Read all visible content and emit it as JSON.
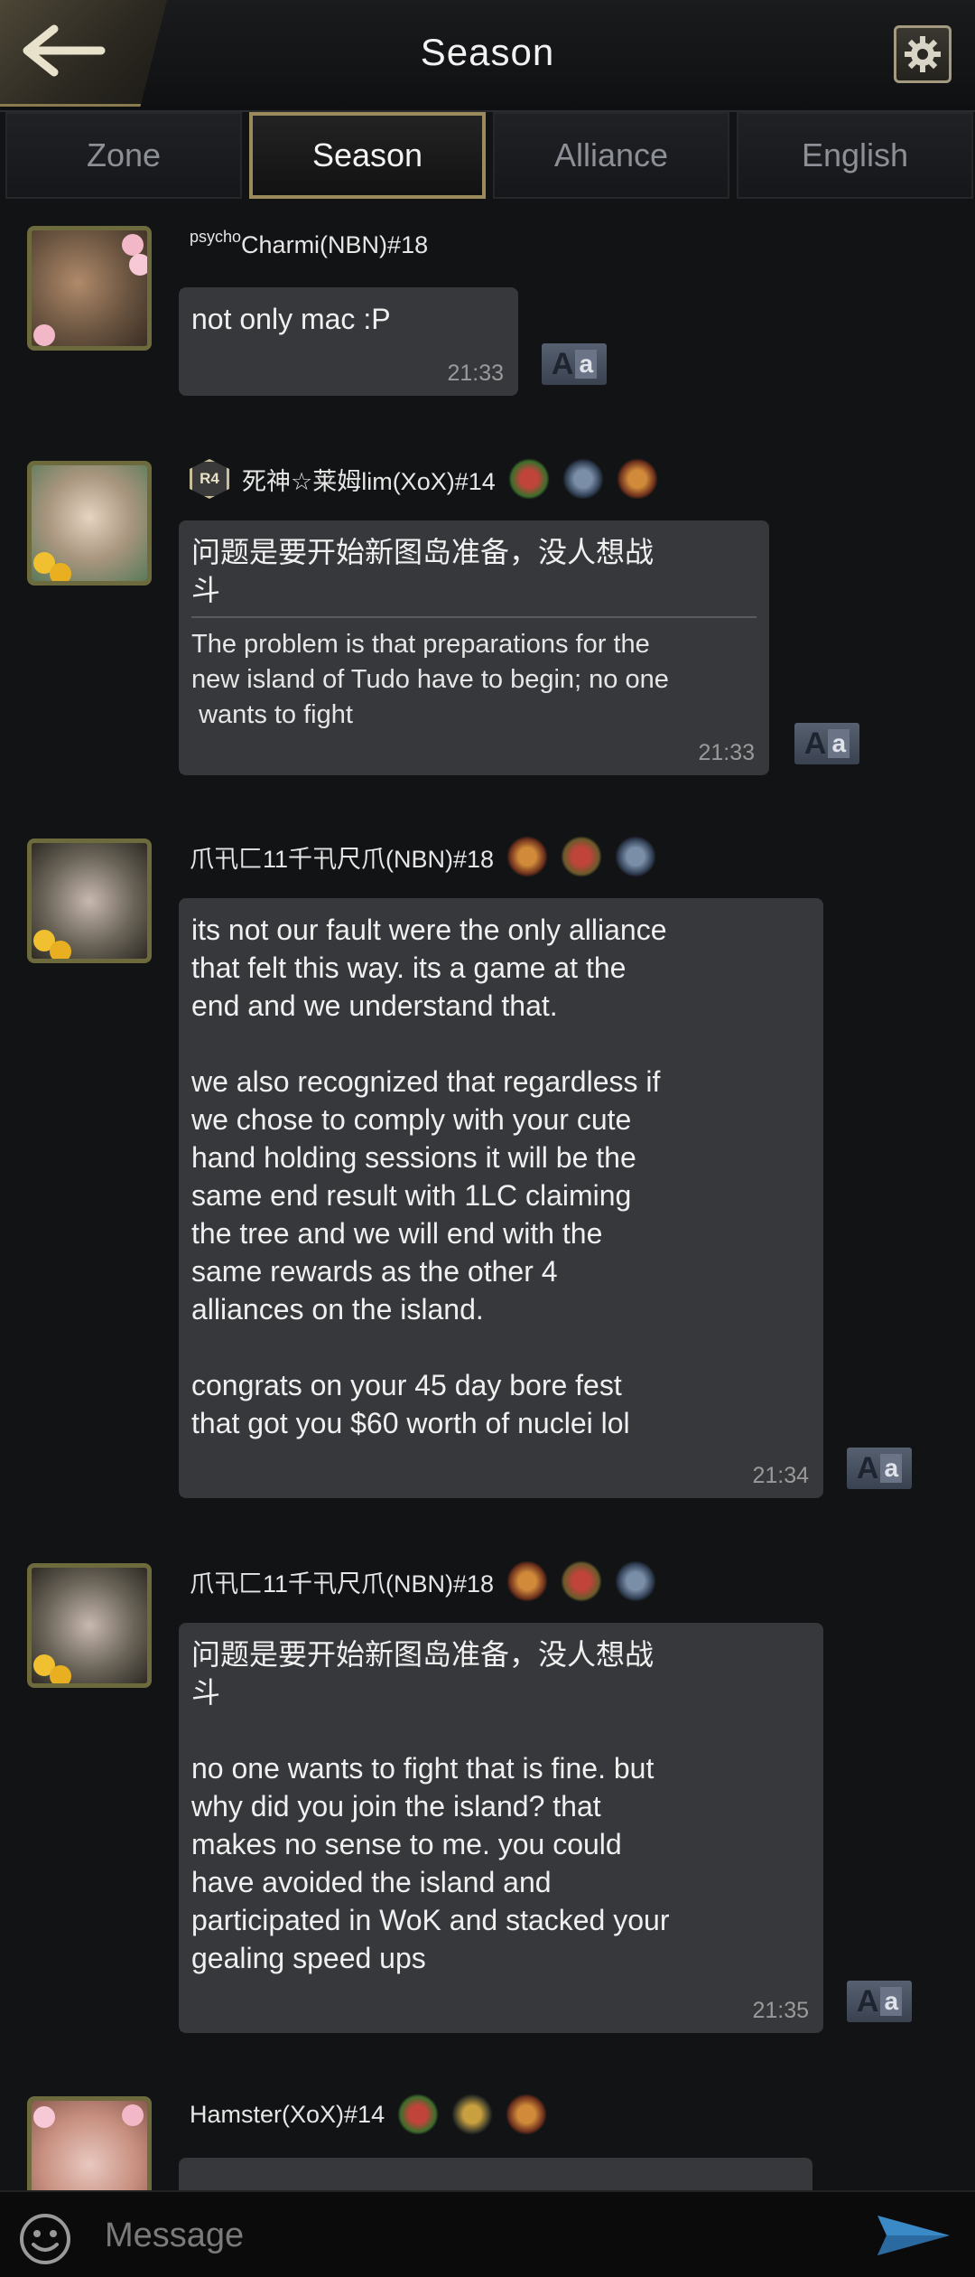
{
  "header": {
    "title": "Season",
    "back_icon": "arrow-left-icon",
    "settings_icon": "gear-icon"
  },
  "tabs": [
    {
      "label": "Zone",
      "active": false
    },
    {
      "label": "Season",
      "active": true
    },
    {
      "label": "Alliance",
      "active": false
    },
    {
      "label": "English",
      "active": false
    }
  ],
  "messages": [
    {
      "name_prefix": "psycho",
      "name": "Charmi(NBN)#18",
      "text": "not only mac :P",
      "time": "21:33"
    },
    {
      "rank": "R4",
      "name": "死神☆莱姆lim(XoX)#14",
      "original": "问题是要开始新图岛准备，没人想战\n斗",
      "translation": "The problem is that preparations for the\nnew island of Tudo have to begin; no one\n wants to fight",
      "time": "21:33"
    },
    {
      "name": "爪卂匚11千卂尺爪(NBN)#18",
      "text": "its not our fault were the only alliance\nthat felt this way. its a game at the\nend and we understand that.\n\nwe also recognized that regardless if\nwe chose to comply with your cute\nhand holding sessions it will be the\nsame end result with 1LC claiming\nthe tree and we will end with the\nsame rewards as the other 4\nalliances on the island.\n\ncongrats on your 45 day bore fest\nthat got you $60 worth of nuclei lol",
      "time": "21:34"
    },
    {
      "name": "爪卂匚11千卂尺爪(NBN)#18",
      "text": "问题是要开始新图岛准备，没人想战\n斗\n\nno one wants to fight that is fine. but\nwhy did you join the island? that\nmakes no sense to me. you could\nhave avoided the island and\nparticipated in WoK and stacked your\ngealing speed ups",
      "time": "21:35"
    },
    {
      "name": "Hamster(XoX)#14"
    }
  ],
  "translate_button": {
    "big": "A",
    "small": "a"
  },
  "input": {
    "placeholder": "Message"
  },
  "colors": {
    "accent_gold": "#9a8a5c",
    "bubble": "#37383b",
    "background": "#121314"
  }
}
